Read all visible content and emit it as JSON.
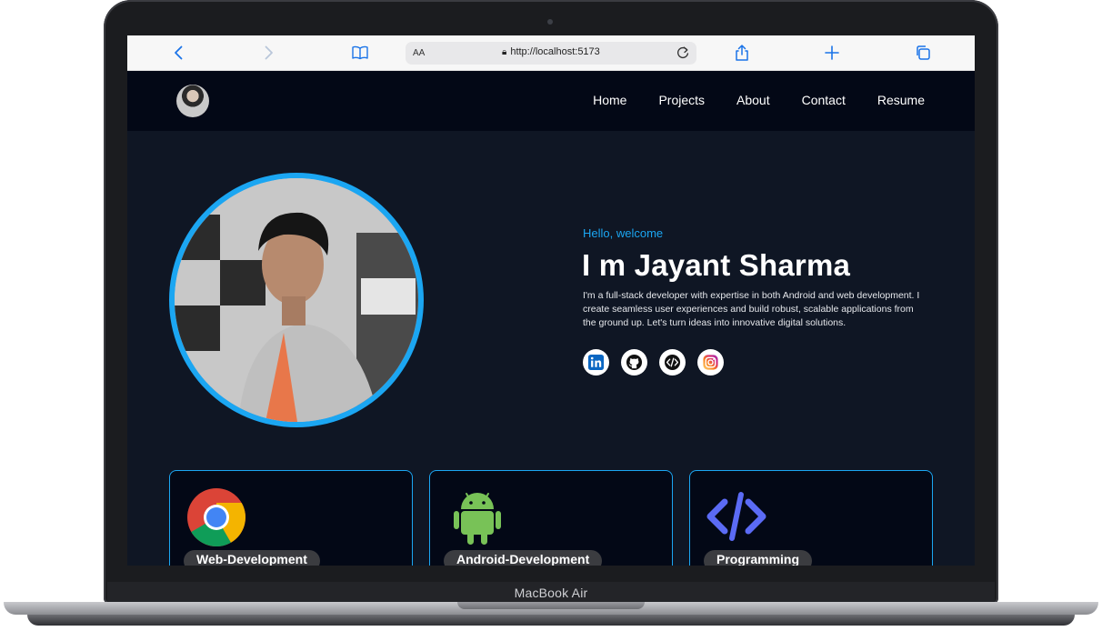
{
  "browser": {
    "text_size_label": "AA",
    "url": "http://localhost:5173"
  },
  "device": {
    "label": "MacBook Air"
  },
  "site": {
    "nav": {
      "items": [
        "Home",
        "Projects",
        "About",
        "Contact",
        "Resume"
      ]
    },
    "hero": {
      "greeting": "Hello, welcome",
      "name": "I m Jayant Sharma",
      "bio": "I'm a full-stack developer with expertise in both Android and web development. I create seamless user experiences and build robust, scalable applications from the ground up. Let's turn ideas into innovative digital solutions.",
      "socials": [
        "linkedin-icon",
        "github-icon",
        "code-icon",
        "instagram-icon"
      ]
    },
    "services": [
      {
        "label": "Web-Development",
        "icon": "chrome-icon"
      },
      {
        "label": "Android-Development",
        "icon": "android-icon"
      },
      {
        "label": "Programming",
        "icon": "code-brackets-icon"
      }
    ]
  },
  "colors": {
    "accent": "#1ba6f2",
    "background": "#0f1624",
    "nav_background": "#030816",
    "pill": "#3b3c40"
  }
}
